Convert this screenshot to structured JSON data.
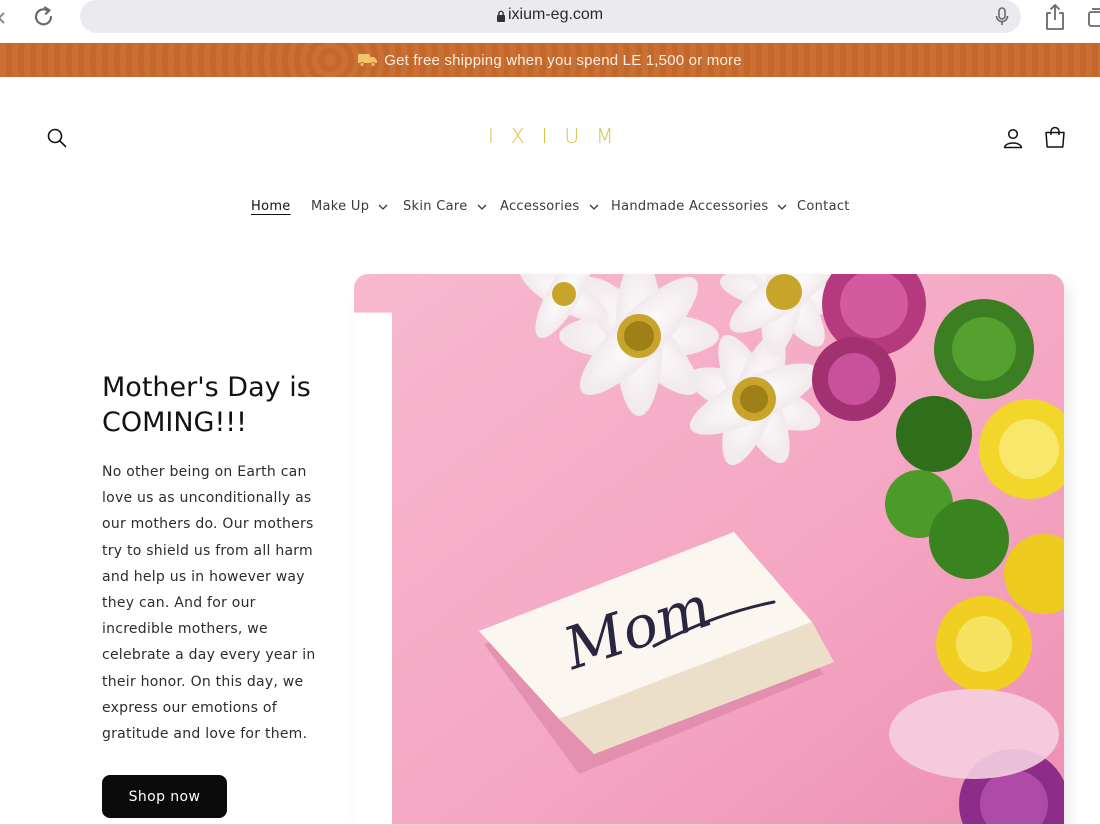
{
  "browser": {
    "url": "ixium-eg.com",
    "icons": [
      "back-icon",
      "reload-icon",
      "lock-icon",
      "microphone-icon",
      "share-icon",
      "tabs-icon"
    ]
  },
  "announcement": {
    "text": "Get free shipping when you spend LE 1,500 or more",
    "icon": "truck-icon",
    "background": "#c96a2c"
  },
  "header": {
    "logo": "IXIUM",
    "logo_color": "#d9c04a",
    "icons": [
      "search-icon",
      "account-icon",
      "cart-icon"
    ]
  },
  "nav": {
    "items": [
      {
        "label": "Home",
        "active": true,
        "dropdown": false
      },
      {
        "label": "Make Up",
        "active": false,
        "dropdown": true
      },
      {
        "label": "Skin Care",
        "active": false,
        "dropdown": true
      },
      {
        "label": "Accessories",
        "active": false,
        "dropdown": true
      },
      {
        "label": "Handmade Accessories",
        "active": false,
        "dropdown": true
      },
      {
        "label": "Contact",
        "active": false,
        "dropdown": false
      }
    ]
  },
  "hero": {
    "title_line1": "Mother's Day is",
    "title_line2": "COMING!!!",
    "body": "No other being on Earth can love us as unconditionally as our mothers do. Our mothers try to shield us from all harm and help us in however way they can. And for our incredible mothers, we celebrate a day every year in their honor. On this day, we express our emotions of gratitude and love for them.",
    "button_label": "Shop now",
    "card_text": "Mom"
  }
}
